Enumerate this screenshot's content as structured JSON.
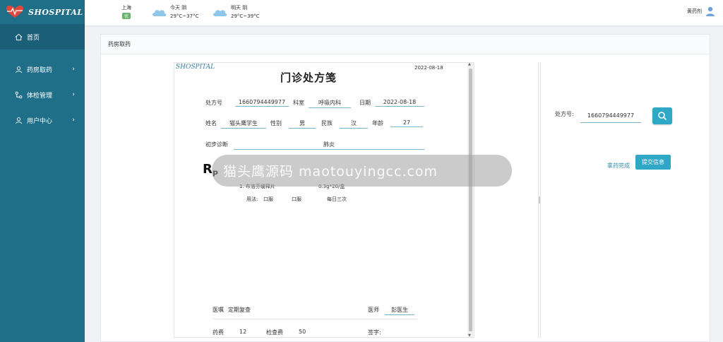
{
  "brand": {
    "name": "SHOSPITAL"
  },
  "sidebar": {
    "items": [
      {
        "label": "首页",
        "icon": "home-icon"
      },
      {
        "label": "药房取药",
        "icon": "user-icon"
      },
      {
        "label": "体检管理",
        "icon": "network-icon"
      },
      {
        "label": "用户中心",
        "icon": "user-icon"
      }
    ]
  },
  "header": {
    "city": "上海",
    "aqi": "优",
    "today": {
      "label": "今天 阴",
      "temp": "29°C~37°C"
    },
    "tomorrow": {
      "label": "明天 阴",
      "temp": "29°C~39°C"
    },
    "user": "黄药剂"
  },
  "panel": {
    "title": "药房取药"
  },
  "rx": {
    "logo": "SHOSPITAL",
    "date_top": "2022-08-18",
    "title": "门诊处方笺",
    "labels": {
      "rx_no": "处方号",
      "dept": "科室",
      "date": "日期",
      "name": "姓名",
      "gender": "性别",
      "ethnicity": "民族",
      "age": "年龄",
      "diagnosis": "初步诊断",
      "advice": "医嘱",
      "doctor": "医师",
      "drug_fee": "药费",
      "exam_fee": "检查费",
      "sign": "签字:"
    },
    "values": {
      "rx_no": "1660794449977",
      "dept": "呼吸内科",
      "date": "2022-08-18",
      "name": "猫头鹰学生",
      "gender": "男",
      "ethnicity": "汉",
      "age": "27",
      "diagnosis": "肺炎",
      "advice": "定期复查",
      "doctor": "彭医生",
      "drug_fee": "12",
      "exam_fee": "50"
    },
    "rp": "R",
    "rp_sub": "P",
    "drug": {
      "name": "1. 布洛芬缓释片",
      "spec": "0.3g*20/盒",
      "usage_label": "用法:",
      "route1": "口服",
      "route2": "口服",
      "freq": "每日三次"
    }
  },
  "banner": "猫头鹰源码 maotouyingcc.com",
  "search": {
    "label": "处方号:",
    "value": "1660794449977"
  },
  "actions": {
    "done": "拿药完成",
    "submit": "提交信息"
  },
  "colors": {
    "sidebar": "#1f6f89",
    "accent": "#2fa8c6"
  }
}
